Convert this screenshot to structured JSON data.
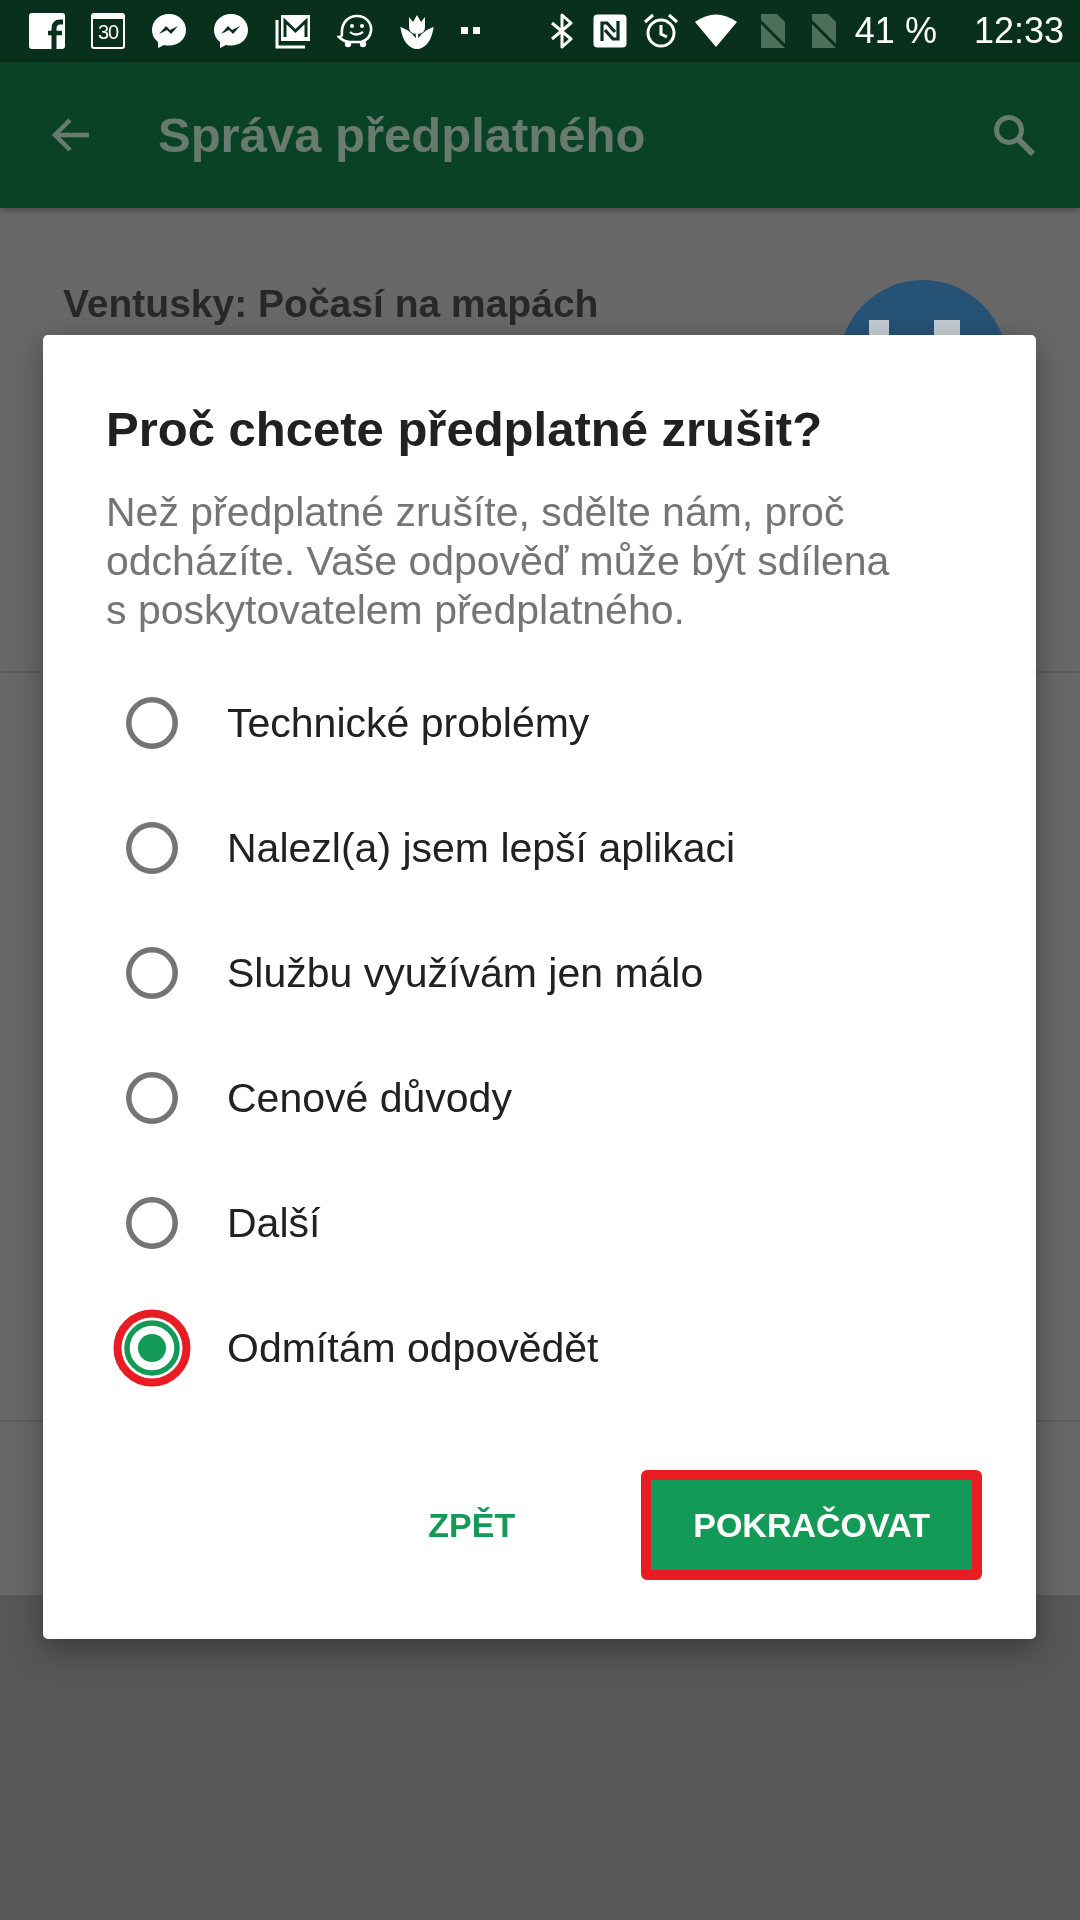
{
  "status_bar": {
    "calendar_day": "30",
    "battery": "41 %",
    "time": "12:33"
  },
  "app_bar": {
    "title": "Správa předplatného"
  },
  "subscription": {
    "name": "Ventusky: Počasí na mapách"
  },
  "dialog": {
    "title": "Proč chcete předplatné zrušit?",
    "message": "Než předplatné zrušíte, sdělte nám, proč odcházíte. Vaše odpověď může být sdílena s poskytovatelem předplatného.",
    "options": [
      {
        "label": "Technické problémy",
        "selected": false,
        "highlighted": false
      },
      {
        "label": "Nalezl(a) jsem lepší aplikaci",
        "selected": false,
        "highlighted": false
      },
      {
        "label": "Službu využívám jen málo",
        "selected": false,
        "highlighted": false
      },
      {
        "label": "Cenové důvody",
        "selected": false,
        "highlighted": false
      },
      {
        "label": "Další",
        "selected": false,
        "highlighted": false
      },
      {
        "label": "Odmítám odpovědět",
        "selected": true,
        "highlighted": true
      }
    ],
    "buttons": [
      {
        "label": "ZPĚT",
        "kind": "text",
        "highlighted": false
      },
      {
        "label": "POKRAČOVAT",
        "kind": "filled",
        "highlighted": true
      }
    ]
  }
}
